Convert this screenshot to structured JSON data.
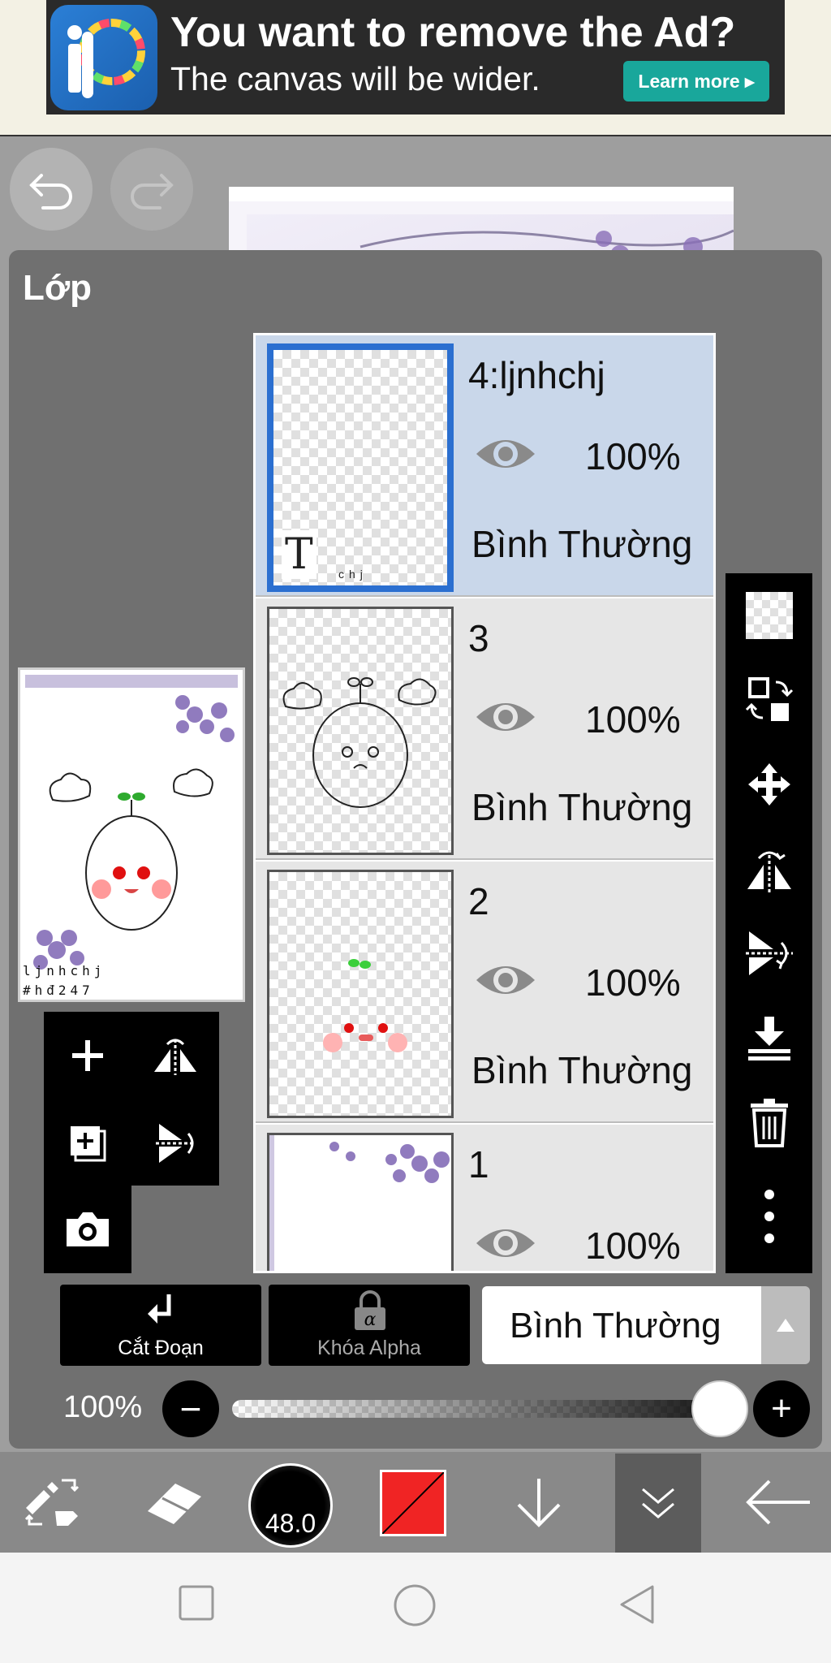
{
  "ad": {
    "title": "You want to remove the Ad?",
    "subtitle": "The canvas will be wider.",
    "cta": "Learn more ▸",
    "logo_icon": "ibispaint-logo-icon"
  },
  "panel": {
    "title": "Lớp"
  },
  "preview": {
    "caption_line1": "ljnhchj",
    "caption_line2": "#hđ247"
  },
  "layers": [
    {
      "name": "4:ljnhchj",
      "opacity": "100%",
      "blend": "Bình Thường",
      "selected": true,
      "thumb_text": "T",
      "thumb_small": "chj"
    },
    {
      "name": "3",
      "opacity": "100%",
      "blend": "Bình Thường",
      "selected": false
    },
    {
      "name": "2",
      "opacity": "100%",
      "blend": "Bình Thường",
      "selected": false
    },
    {
      "name": "1",
      "opacity": "100%",
      "blend": "Bình Thường",
      "selected": false
    }
  ],
  "controls": {
    "clipping_label": "Cắt Đoạn",
    "alpha_lock_label": "Khóa Alpha",
    "blend_mode": "Bình Thường",
    "opacity_label": "100%",
    "opacity_value": 1.0,
    "minus": "−",
    "plus": "+"
  },
  "toolbar": {
    "brush_size": "48.0",
    "color": "#f02424"
  },
  "colors": {
    "selected_border": "#2b6fd0",
    "selected_row": "#c9d7ea",
    "panel_bg": "#707070",
    "ad_cta": "#19a79b"
  }
}
